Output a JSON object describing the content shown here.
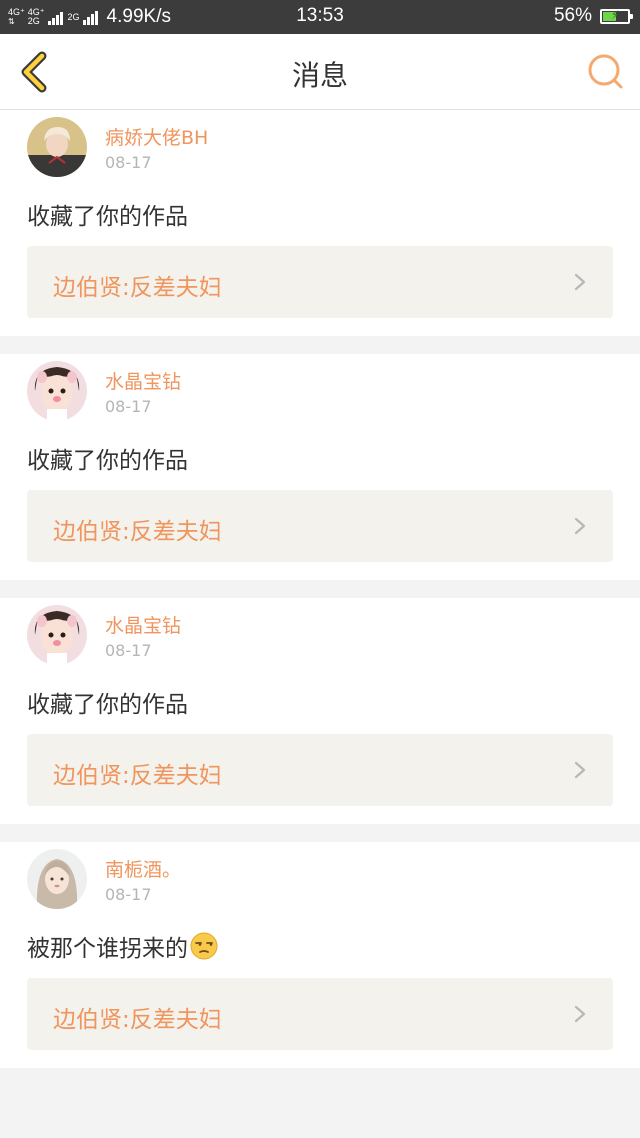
{
  "status_bar": {
    "network_1": "4G⁺",
    "network_1b": "4G⁺",
    "network_2": "2G",
    "network_2b": "2G",
    "speed": "4.99K/s",
    "time": "13:53",
    "battery_percent": "56%",
    "battery_level": 0.56,
    "battery_color": "#6fd54a"
  },
  "navbar": {
    "back_icon": "back-chevron-icon",
    "title": "消息",
    "search_icon": "search-icon",
    "accent_color": "#f6a96f"
  },
  "messages": [
    {
      "user": "病娇大佬BH",
      "date": "08-17",
      "text": "收藏了你的作品",
      "work": "边伯贤:反差夫妇",
      "avatar_icon": "user-avatar"
    },
    {
      "user": "水晶宝钻",
      "date": "08-17",
      "text": "收藏了你的作品",
      "work": "边伯贤:反差夫妇",
      "avatar_icon": "user-avatar"
    },
    {
      "user": "水晶宝钻",
      "date": "08-17",
      "text": "收藏了你的作品",
      "work": "边伯贤:反差夫妇",
      "avatar_icon": "user-avatar"
    },
    {
      "user": "南栀酒。",
      "date": "08-17",
      "text": "被那个谁拐来的",
      "emoji": "unamused-face-emoji",
      "work": "边伯贤:反差夫妇",
      "avatar_icon": "user-avatar"
    }
  ]
}
